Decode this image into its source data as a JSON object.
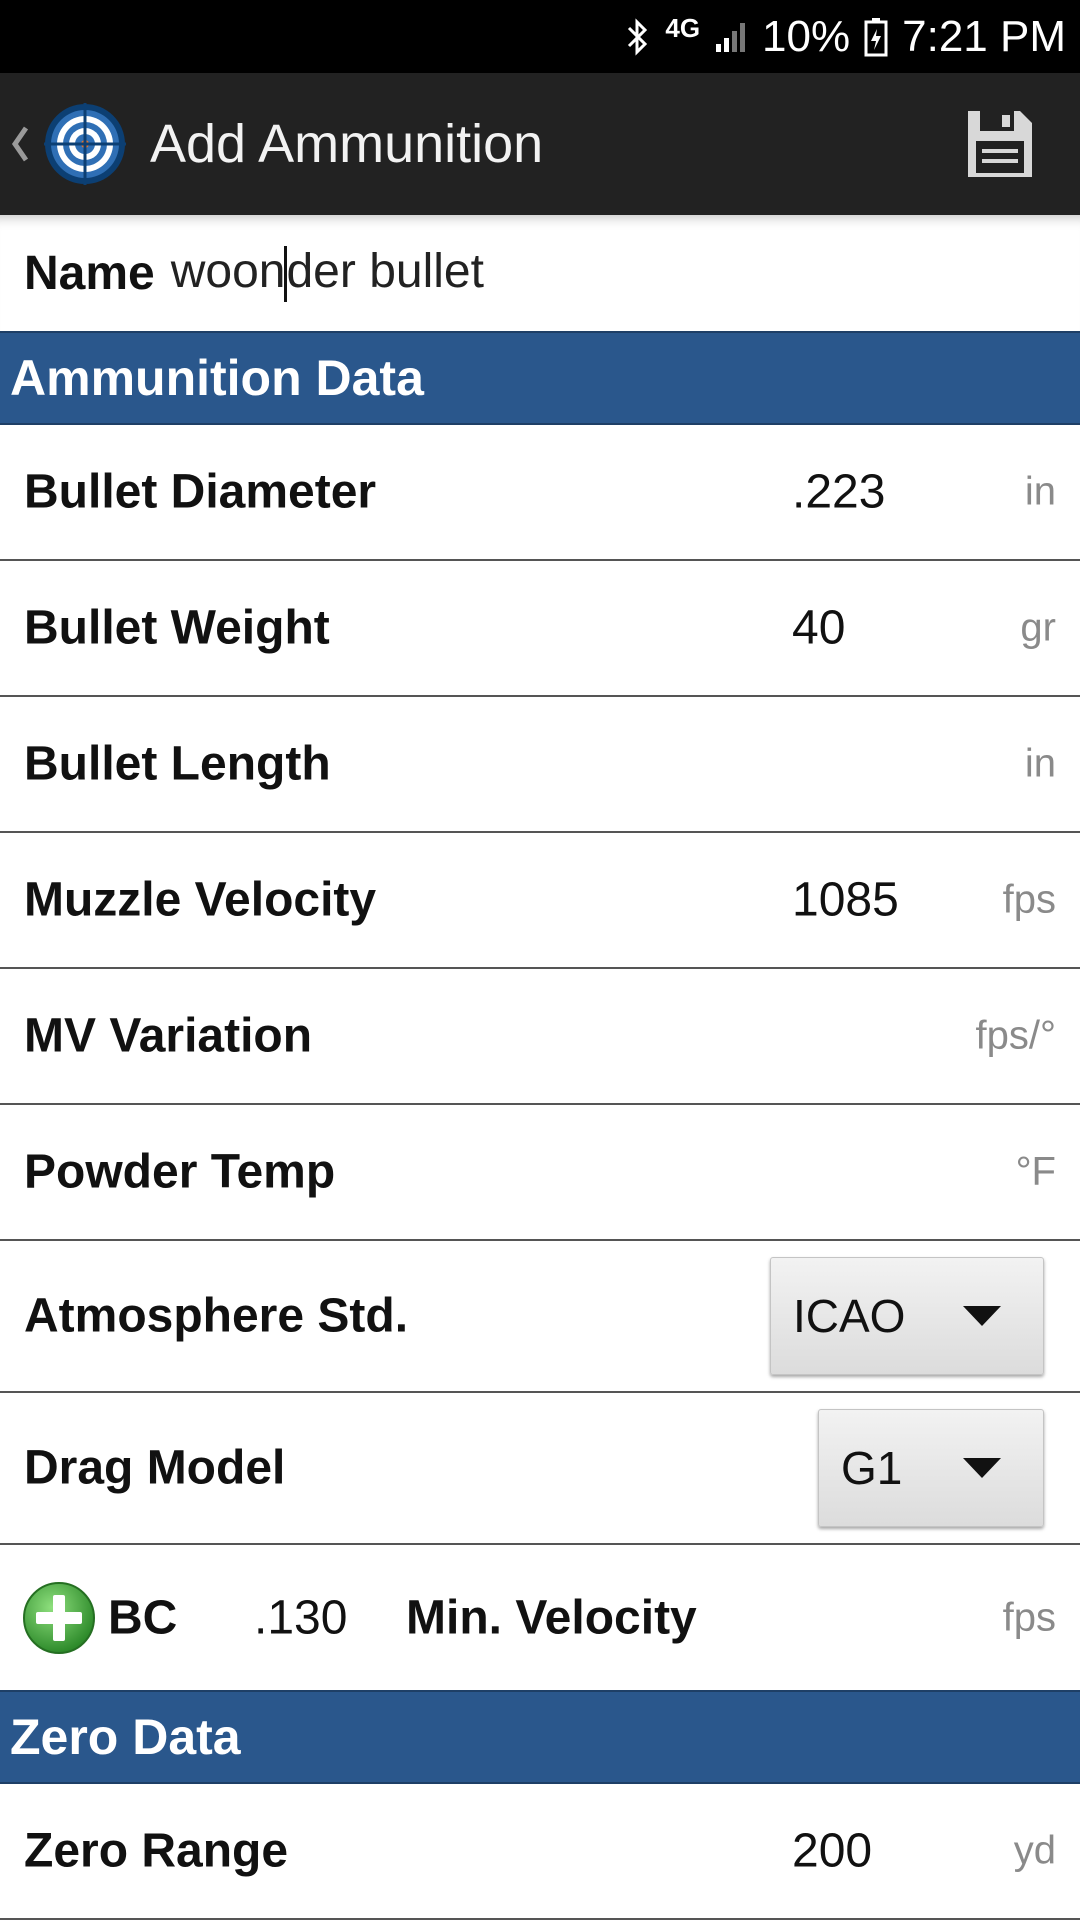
{
  "status_bar": {
    "network": "4G",
    "battery": "10%",
    "time": "7:21 PM"
  },
  "app_bar": {
    "title": "Add Ammunition"
  },
  "name_field": {
    "label": "Name",
    "value_before_cursor": "woon",
    "value_after_cursor": "der bullet"
  },
  "sections": {
    "ammo": "Ammunition Data",
    "zero": "Zero Data"
  },
  "fields": [
    {
      "label": "Bullet Diameter",
      "value": ".223",
      "unit": "in"
    },
    {
      "label": "Bullet Weight",
      "value": "40",
      "unit": "gr"
    },
    {
      "label": "Bullet Length",
      "value": "",
      "unit": "in"
    },
    {
      "label": "Muzzle Velocity",
      "value": "1085",
      "unit": "fps"
    },
    {
      "label": "MV Variation",
      "value": "",
      "unit": "fps/°"
    },
    {
      "label": "Powder Temp",
      "value": "",
      "unit": "°F"
    }
  ],
  "atmosphere": {
    "label": "Atmosphere Std.",
    "selected": "ICAO"
  },
  "drag_model": {
    "label": "Drag Model",
    "selected": "G1"
  },
  "bc_row": {
    "bc_label": "BC",
    "bc_value": ".130",
    "min_velocity_label": "Min. Velocity",
    "unit": "fps"
  },
  "zero_range": {
    "label": "Zero Range",
    "value": "200",
    "unit": "yd"
  },
  "colors": {
    "section_header": "#2a578c",
    "app_bar": "#222222",
    "unit_text": "#8a8a8a",
    "add_icon": "#3aa335"
  }
}
